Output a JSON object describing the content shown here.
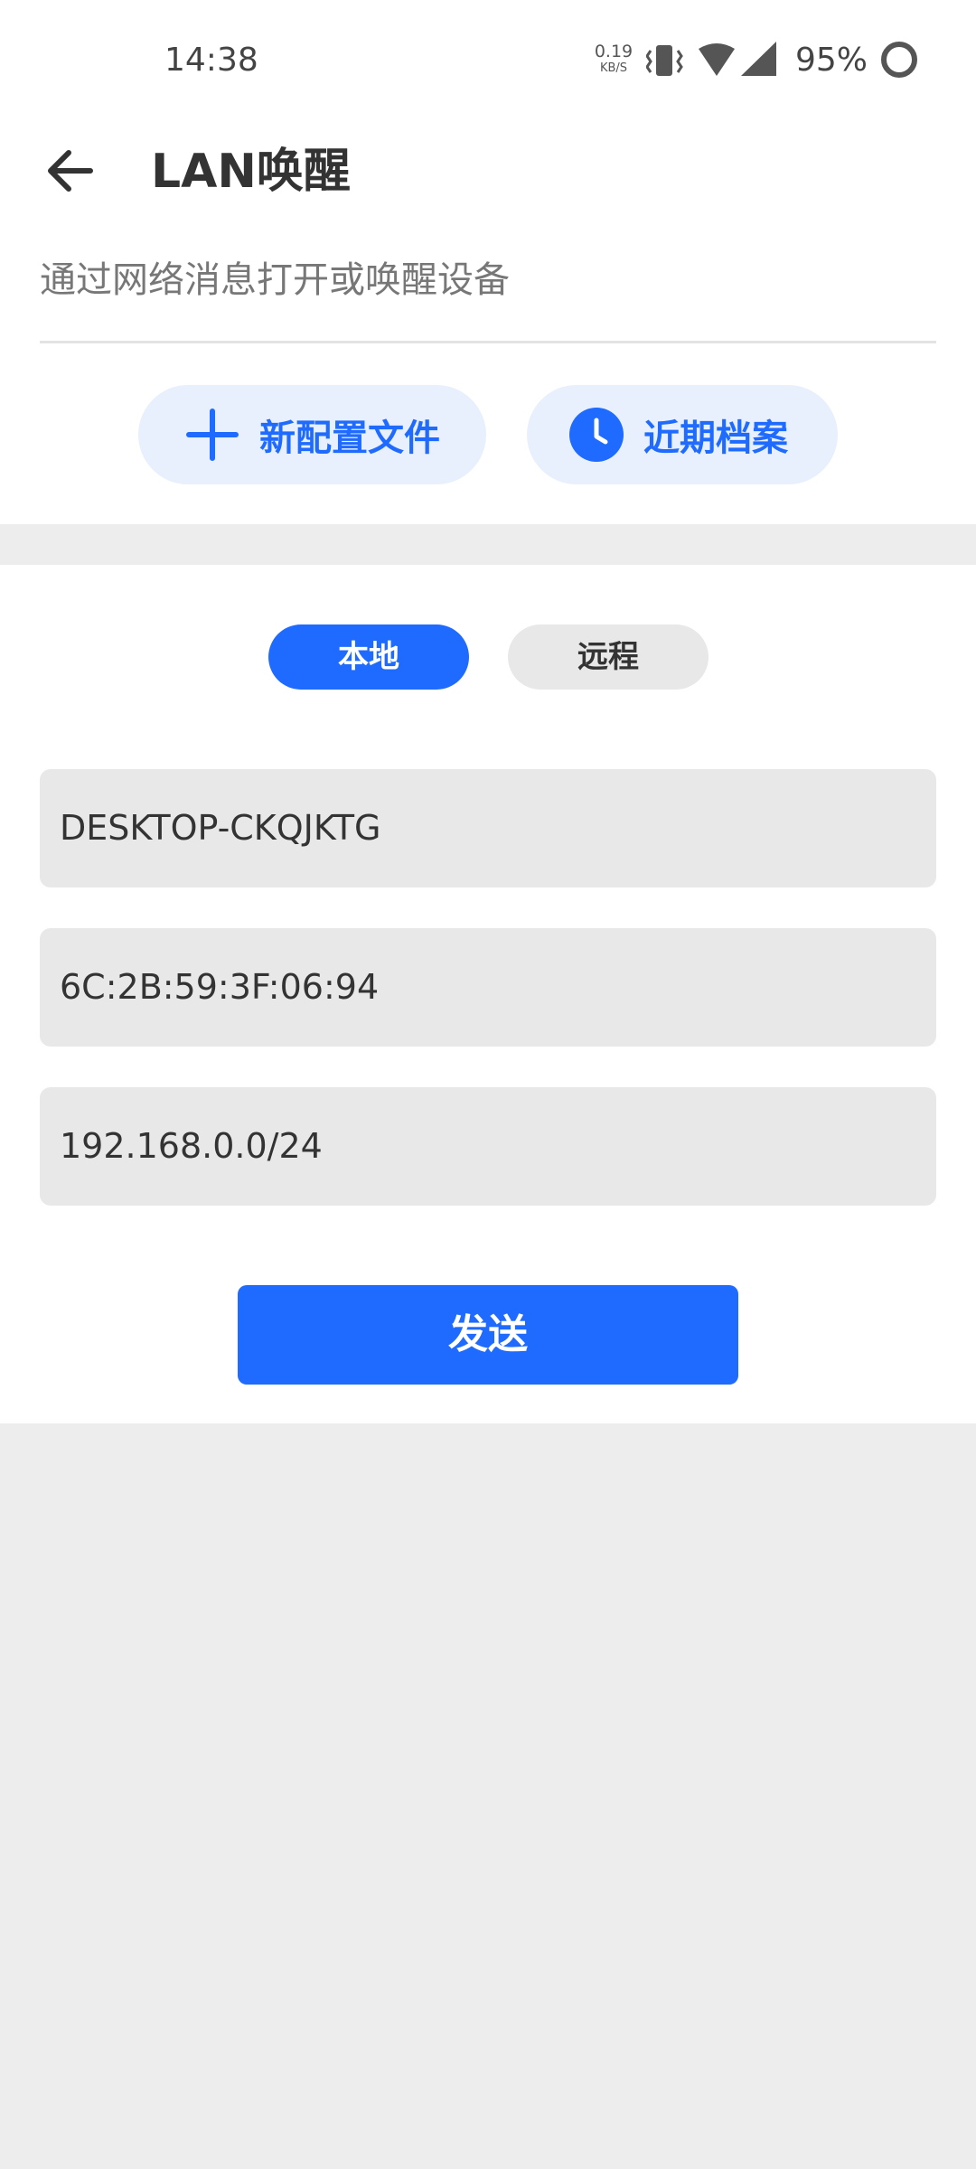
{
  "status_bar": {
    "time": "14:38",
    "net_speed_value": "0.19",
    "net_speed_unit": "KB/S",
    "battery_percent": "95%",
    "icons": [
      "vibrate-icon",
      "wifi-icon",
      "signal-icon",
      "battery-ring-icon"
    ]
  },
  "app_bar": {
    "title": "LAN唤醒",
    "back_icon": "arrow-left-icon"
  },
  "header": {
    "subtitle": "通过网络消息打开或唤醒设备",
    "new_profile_label": "新配置文件",
    "recent_profiles_label": "近期档案"
  },
  "mode_toggle": {
    "local_label": "本地",
    "remote_label": "远程",
    "selected": "本地"
  },
  "form": {
    "hostname": "DESKTOP-CKQJKTG",
    "mac_address": "6C:2B:59:3F:06:94",
    "network": "192.168.0.0/24"
  },
  "send_label": "发送",
  "colors": {
    "accent": "#1f6bff",
    "pill_background": "#e8f0fd",
    "field_background": "#e8e8e8",
    "page_background": "#ededed"
  }
}
